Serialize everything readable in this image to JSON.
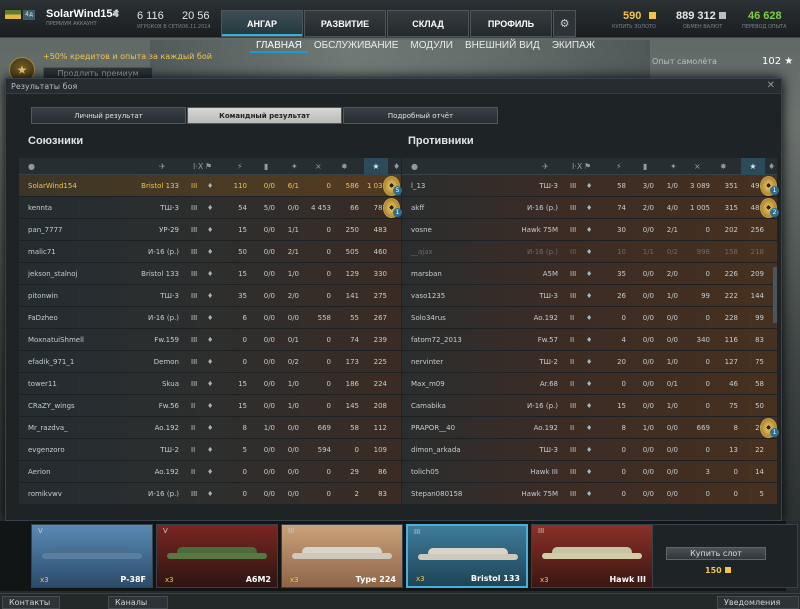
{
  "topbar": {
    "account_name": "SolarWind154",
    "account_sub": "ПРЕМИУМ АККАУНТ",
    "level": "4д",
    "players_online": "6 116",
    "players_online_label": "ИГРОКОВ В СЕТИ",
    "time": "20 56",
    "date": "06.11.2014",
    "tabs": [
      "АНГАР",
      "РАЗВИТИЕ",
      "СКЛАД",
      "ПРОФИЛЬ"
    ],
    "gold": "590",
    "gold_label": "КУПИТЬ ЗОЛОТО",
    "credits": "889 312",
    "credits_label": "ОБМЕН ВАЛЮТ",
    "free_xp": "46 628",
    "free_xp_label": "ПЕРЕВОД ОПЫТА"
  },
  "subnav": [
    "ГЛАВНАЯ",
    "ОБСЛУЖИВАНИЕ",
    "МОДУЛИ",
    "ВНЕШНИЙ ВИД",
    "ЭКИПАЖ"
  ],
  "promo": {
    "text": "+50% кредитов и опыта за каждый бой",
    "button": "Продлить премиум"
  },
  "plane_xp": {
    "label": "Опыт самолёта",
    "value": "102"
  },
  "dialog": {
    "title": "Результаты боя",
    "tabs": [
      "Личный результат",
      "Командный результат",
      "Подробный отчёт"
    ],
    "allies_title": "Союзники",
    "enemies_title": "Противники"
  },
  "allies": [
    {
      "name": "SolarWind154",
      "plane": "Bristol 133",
      "tier": "III",
      "c1": "110",
      "c2": "0/0",
      "c3": "6/1",
      "c4": "0",
      "c5": "586",
      "c6": "1 037",
      "medal": "5"
    },
    {
      "name": "kennta",
      "plane": "ТШ-3",
      "tier": "III",
      "c1": "54",
      "c2": "5/0",
      "c3": "0/0",
      "c4": "4 453",
      "c5": "66",
      "c6": "787",
      "medal": "1"
    },
    {
      "name": "pan_7777",
      "plane": "УР-29",
      "tier": "III",
      "c1": "15",
      "c2": "0/0",
      "c3": "1/1",
      "c4": "0",
      "c5": "250",
      "c6": "483"
    },
    {
      "name": "malic71",
      "plane": "И-16 (р.)",
      "tier": "III",
      "c1": "50",
      "c2": "0/0",
      "c3": "2/1",
      "c4": "0",
      "c5": "505",
      "c6": "460"
    },
    {
      "name": "jekson_stalnoj",
      "plane": "Bristol 133",
      "tier": "III",
      "c1": "15",
      "c2": "0/0",
      "c3": "1/0",
      "c4": "0",
      "c5": "129",
      "c6": "330"
    },
    {
      "name": "pitonwin",
      "plane": "ТШ-3",
      "tier": "III",
      "c1": "35",
      "c2": "0/0",
      "c3": "2/0",
      "c4": "0",
      "c5": "141",
      "c6": "275"
    },
    {
      "name": "FaDzheo",
      "plane": "И-16 (р.)",
      "tier": "III",
      "c1": "6",
      "c2": "0/0",
      "c3": "0/0",
      "c4": "558",
      "c5": "55",
      "c6": "267"
    },
    {
      "name": "MoxnatuiShmell",
      "plane": "Fw.159",
      "tier": "III",
      "c1": "0",
      "c2": "0/0",
      "c3": "0/1",
      "c4": "0",
      "c5": "74",
      "c6": "239"
    },
    {
      "name": "efadik_971_1",
      "plane": "Demon",
      "tier": "III",
      "c1": "0",
      "c2": "0/0",
      "c3": "0/2",
      "c4": "0",
      "c5": "173",
      "c6": "225"
    },
    {
      "name": "tower11",
      "plane": "Skua",
      "tier": "III",
      "c1": "15",
      "c2": "0/0",
      "c3": "1/0",
      "c4": "0",
      "c5": "186",
      "c6": "224"
    },
    {
      "name": "CRaZY_wings",
      "plane": "Fw.56",
      "tier": "II",
      "c1": "15",
      "c2": "0/0",
      "c3": "1/0",
      "c4": "0",
      "c5": "145",
      "c6": "208"
    },
    {
      "name": "Mr_razdva_",
      "plane": "Ao.192",
      "tier": "II",
      "c1": "8",
      "c2": "1/0",
      "c3": "0/0",
      "c4": "669",
      "c5": "58",
      "c6": "112"
    },
    {
      "name": "evgenzoro",
      "plane": "ТШ-2",
      "tier": "II",
      "c1": "5",
      "c2": "0/0",
      "c3": "0/0",
      "c4": "594",
      "c5": "0",
      "c6": "109"
    },
    {
      "name": "Aerion",
      "plane": "Ao.192",
      "tier": "II",
      "c1": "0",
      "c2": "0/0",
      "c3": "0/0",
      "c4": "0",
      "c5": "29",
      "c6": "86"
    },
    {
      "name": "romikvwv",
      "plane": "И-16 (р.)",
      "tier": "III",
      "c1": "0",
      "c2": "0/0",
      "c3": "0/0",
      "c4": "0",
      "c5": "2",
      "c6": "83"
    }
  ],
  "enemies": [
    {
      "name": "l_13",
      "plane": "ТШ-3",
      "tier": "III",
      "c1": "58",
      "c2": "3/0",
      "c3": "1/0",
      "c4": "3 089",
      "c5": "351",
      "c6": "491",
      "medal": "1"
    },
    {
      "name": "akff",
      "plane": "И-16 (р.)",
      "tier": "III",
      "c1": "74",
      "c2": "2/0",
      "c3": "4/0",
      "c4": "1 005",
      "c5": "315",
      "c6": "482",
      "medal": "2"
    },
    {
      "name": "vosne",
      "plane": "Hawk 75M",
      "tier": "III",
      "c1": "30",
      "c2": "0/0",
      "c3": "2/1",
      "c4": "0",
      "c5": "202",
      "c6": "256"
    },
    {
      "name": "__ajax",
      "plane": "И-16 (р.)",
      "tier": "III",
      "c1": "10",
      "c2": "1/1",
      "c3": "0/2",
      "c4": "998",
      "c5": "158",
      "c6": "218"
    },
    {
      "name": "marsban",
      "plane": "А5М",
      "tier": "III",
      "c1": "35",
      "c2": "0/0",
      "c3": "2/0",
      "c4": "0",
      "c5": "226",
      "c6": "209"
    },
    {
      "name": "vaso1235",
      "plane": "ТШ-3",
      "tier": "III",
      "c1": "26",
      "c2": "0/0",
      "c3": "1/0",
      "c4": "99",
      "c5": "222",
      "c6": "144"
    },
    {
      "name": "Solo34rus",
      "plane": "Ao.192",
      "tier": "II",
      "c1": "0",
      "c2": "0/0",
      "c3": "0/0",
      "c4": "0",
      "c5": "228",
      "c6": "99"
    },
    {
      "name": "fatom72_2013",
      "plane": "Fw.57",
      "tier": "II",
      "c1": "4",
      "c2": "0/0",
      "c3": "0/0",
      "c4": "340",
      "c5": "116",
      "c6": "83"
    },
    {
      "name": "nervinter",
      "plane": "ТШ-2",
      "tier": "II",
      "c1": "20",
      "c2": "0/0",
      "c3": "1/0",
      "c4": "0",
      "c5": "127",
      "c6": "75"
    },
    {
      "name": "Max_m09",
      "plane": "Ar.68",
      "tier": "II",
      "c1": "0",
      "c2": "0/0",
      "c3": "0/1",
      "c4": "0",
      "c5": "46",
      "c6": "58"
    },
    {
      "name": "Camabika",
      "plane": "И-16 (р.)",
      "tier": "III",
      "c1": "15",
      "c2": "0/0",
      "c3": "1/0",
      "c4": "0",
      "c5": "75",
      "c6": "50"
    },
    {
      "name": "PRAPOR__40",
      "plane": "Ao.192",
      "tier": "II",
      "c1": "8",
      "c2": "1/0",
      "c3": "0/0",
      "c4": "669",
      "c5": "8",
      "c6": "29",
      "medal": "1"
    },
    {
      "name": "dimon_arkada",
      "plane": "ТШ-3",
      "tier": "III",
      "c1": "0",
      "c2": "0/0",
      "c3": "0/0",
      "c4": "0",
      "c5": "13",
      "c6": "22"
    },
    {
      "name": "tolich05",
      "plane": "Hawk III",
      "tier": "III",
      "c1": "0",
      "c2": "0/0",
      "c3": "0/0",
      "c4": "3",
      "c5": "0",
      "c6": "14"
    },
    {
      "name": "Stepan080158",
      "plane": "Hawk 75M",
      "tier": "III",
      "c1": "0",
      "c2": "0/0",
      "c3": "0/0",
      "c4": "0",
      "c5": "0",
      "c6": "5"
    }
  ],
  "carousel": [
    {
      "name": "P-38F",
      "tier": "V",
      "crew": "x3"
    },
    {
      "name": "A6M2",
      "tier": "V",
      "crew": "x3"
    },
    {
      "name": "Type 224",
      "tier": "III",
      "crew": "x3"
    },
    {
      "name": "Bristol 133",
      "tier": "III",
      "crew": "x3"
    },
    {
      "name": "Hawk III",
      "tier": "III",
      "crew": "x3"
    }
  ],
  "buy_slot": {
    "label": "Купить слот",
    "cost": "150"
  },
  "bottombar": {
    "contacts": "Контакты",
    "channels": "Каналы",
    "notifications": "Уведомления"
  }
}
